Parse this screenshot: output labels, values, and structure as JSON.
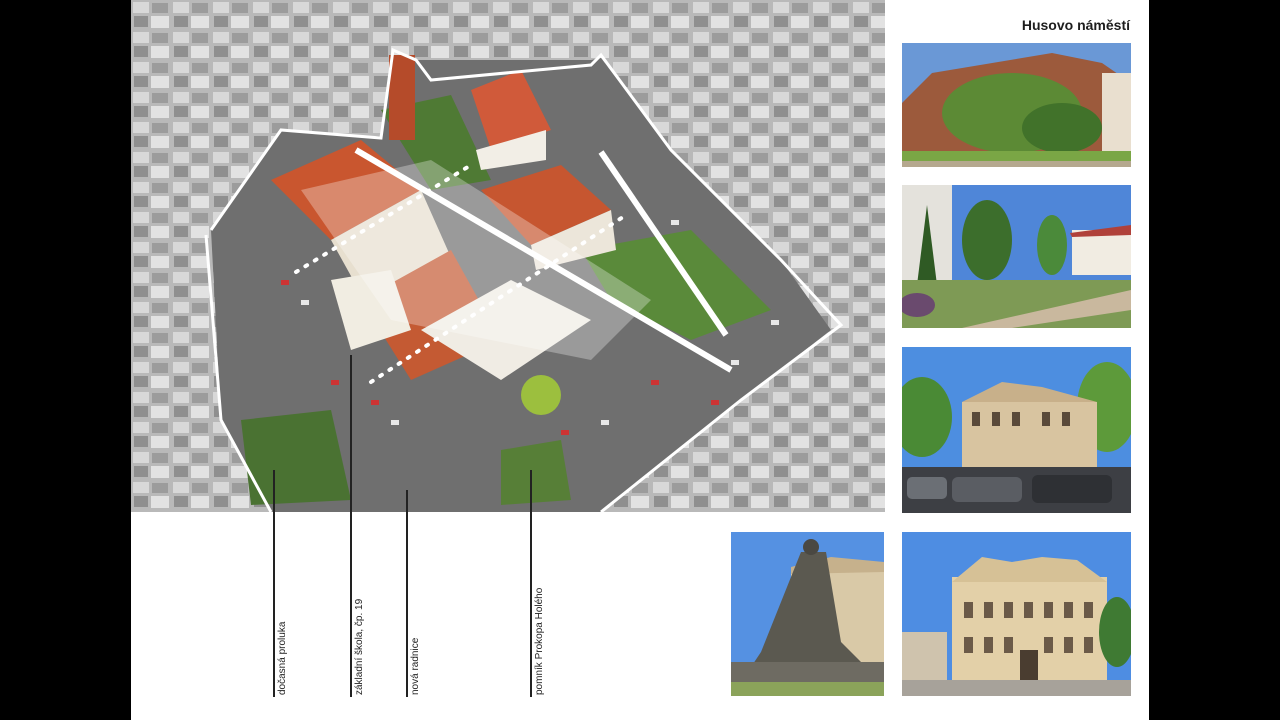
{
  "title": "Husovo náměstí",
  "labels": [
    "dočasná proluka",
    "základní škola, čp. 19",
    "nová radnice",
    "pomník Prokopa Holého"
  ]
}
